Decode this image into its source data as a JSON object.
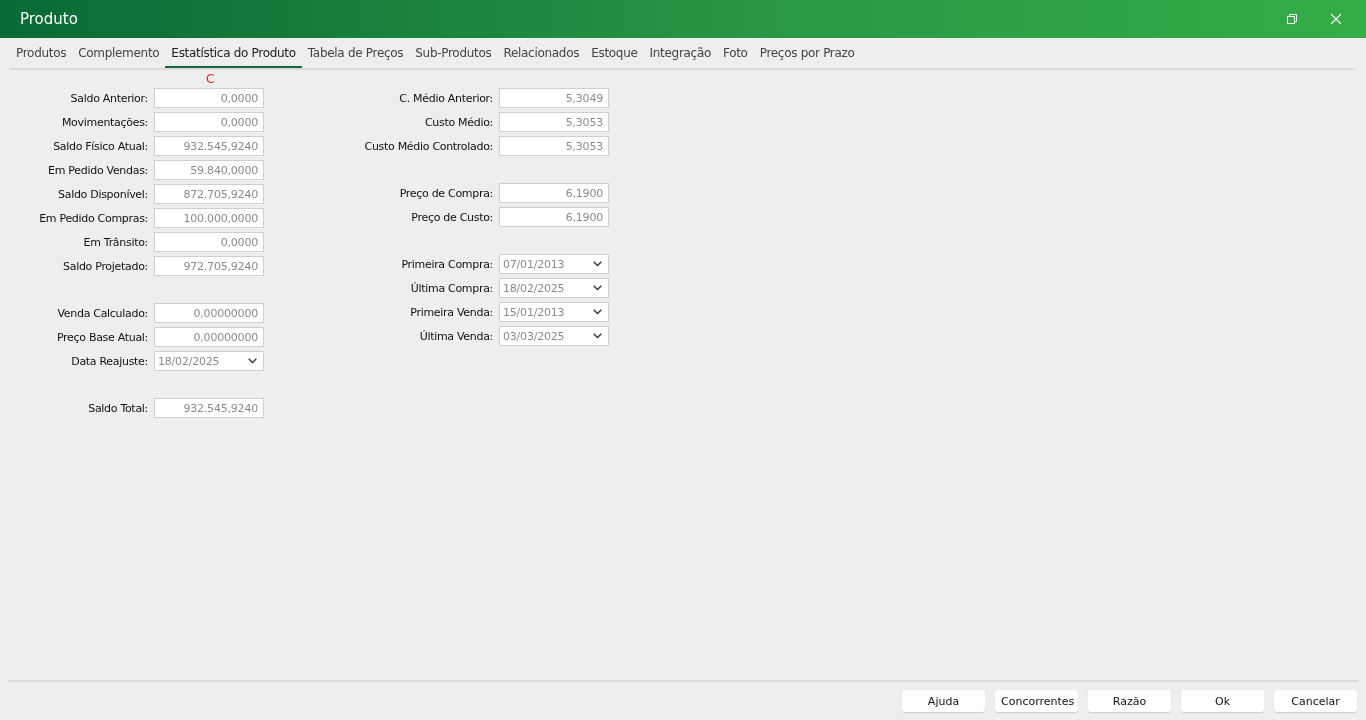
{
  "window": {
    "title": "Produto"
  },
  "tabs": [
    {
      "label": "Produtos",
      "selected": false
    },
    {
      "label": "Complemento",
      "selected": false
    },
    {
      "label": "Estatística do Produto",
      "selected": true
    },
    {
      "label": "Tabela de Preços",
      "selected": false
    },
    {
      "label": "Sub-Produtos",
      "selected": false
    },
    {
      "label": "Relacionados",
      "selected": false
    },
    {
      "label": "Estoque",
      "selected": false
    },
    {
      "label": "Integração",
      "selected": false
    },
    {
      "label": "Foto",
      "selected": false
    },
    {
      "label": "Preços por Prazo",
      "selected": false
    }
  ],
  "marker": "C",
  "left_groups": [
    [
      {
        "kind": "number",
        "label": "Saldo Anterior:",
        "value": "0,0000"
      },
      {
        "kind": "number",
        "label": "Movimentações:",
        "value": "0,0000"
      },
      {
        "kind": "number",
        "label": "Saldo Físico Atual:",
        "value": "932.545,9240"
      },
      {
        "kind": "number",
        "label": "Em Pedido Vendas:",
        "value": "59.840,0000"
      },
      {
        "kind": "number",
        "label": "Saldo Disponível:",
        "value": "872.705,9240"
      },
      {
        "kind": "number",
        "label": "Em Pedido Compras:",
        "value": "100.000,0000"
      },
      {
        "kind": "number",
        "label": "Em Trânsito:",
        "value": "0,0000"
      },
      {
        "kind": "number",
        "label": "Saldo Projetado:",
        "value": "972.705,9240"
      }
    ],
    [
      {
        "kind": "number",
        "label": "Venda Calculado:",
        "value": "0,00000000"
      },
      {
        "kind": "number",
        "label": "Preço Base Atual:",
        "value": "0,00000000"
      },
      {
        "kind": "date",
        "label": "Data Reajuste:",
        "value": "18/02/2025"
      }
    ],
    [
      {
        "kind": "number",
        "label": "Saldo Total:",
        "value": "932.545,9240"
      }
    ]
  ],
  "right_groups": [
    [
      {
        "kind": "number",
        "label": "C. Médio Anterior:",
        "value": "5,3049"
      },
      {
        "kind": "number",
        "label": "Custo Médio:",
        "value": "5,3053"
      },
      {
        "kind": "number",
        "label": "Custo Médio Controlado:",
        "value": "5,3053"
      }
    ],
    [
      {
        "kind": "number",
        "label": "Preço de Compra:",
        "value": "6,1900"
      },
      {
        "kind": "number",
        "label": "Preço de Custo:",
        "value": "6,1900"
      }
    ],
    [
      {
        "kind": "date",
        "label": "Primeira Compra:",
        "value": "07/01/2013"
      },
      {
        "kind": "date",
        "label": "Última Compra:",
        "value": "18/02/2025"
      },
      {
        "kind": "date",
        "label": "Primeira Venda:",
        "value": "15/01/2013"
      },
      {
        "kind": "date",
        "label": "Última Venda:",
        "value": "03/03/2025"
      }
    ]
  ],
  "buttons": [
    "Ajuda",
    "Concorrentes",
    "Razão",
    "Ok",
    "Cancelar"
  ]
}
